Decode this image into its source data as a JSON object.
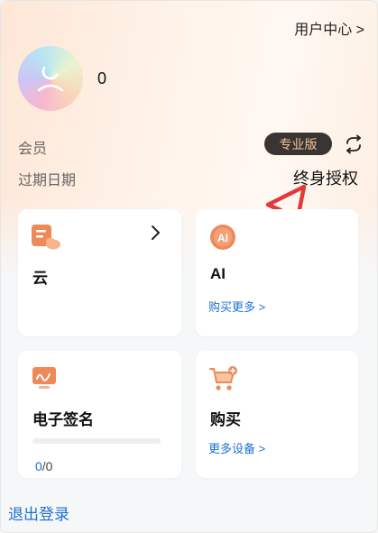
{
  "header": {
    "user_center_label": "用户中心 >"
  },
  "user": {
    "name": "0"
  },
  "membership": {
    "member_label": "会员",
    "tier_badge": "专业版",
    "expire_label": "过期日期",
    "expire_value": "终身授权"
  },
  "cards": {
    "cloud": {
      "title": "云",
      "icon": "cloud-icon"
    },
    "ai": {
      "title": "AI",
      "link": "购买更多 >",
      "icon": "ai-icon"
    },
    "esign": {
      "title": "电子签名",
      "used": "0",
      "total": "/0",
      "progress": 0,
      "icon": "signature-icon"
    },
    "buy": {
      "title": "购买",
      "link": "更多设备 >",
      "icon": "cart-icon"
    }
  },
  "footer": {
    "logout_label": "退出登录"
  },
  "colors": {
    "accent": "#f0884a",
    "link": "#1d6fd6",
    "badge_bg": "#3a3532",
    "badge_text": "#f3c398",
    "annotation": "#e23a3a"
  }
}
